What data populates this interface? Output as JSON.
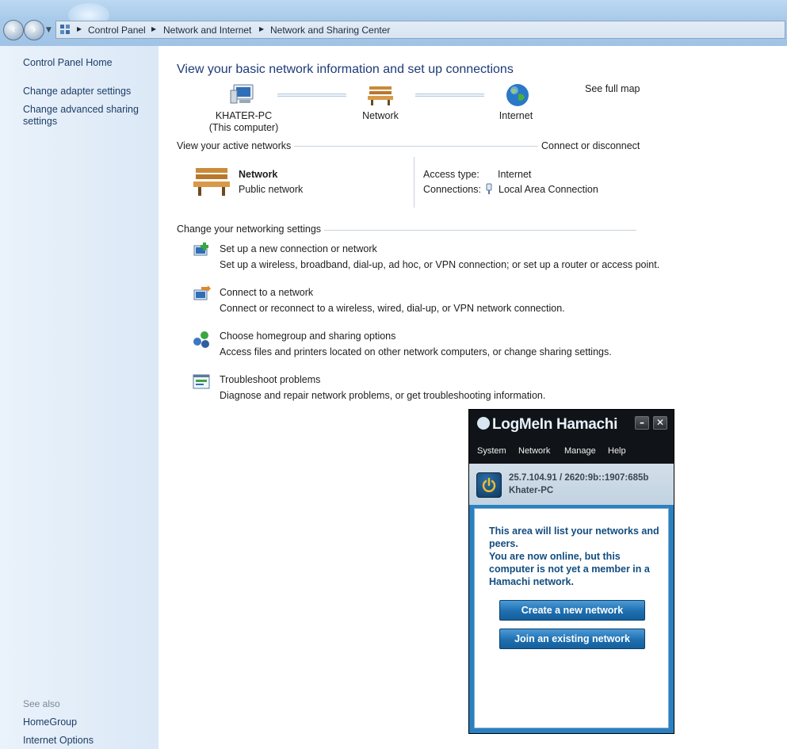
{
  "breadcrumb": [
    "Control Panel",
    "Network and Internet",
    "Network and Sharing Center"
  ],
  "sidebar": {
    "items": [
      {
        "label": "Control Panel Home"
      },
      {
        "label": "Change adapter settings"
      },
      {
        "label": "Change advanced sharing settings"
      }
    ],
    "see_also_label": "See also",
    "see_also": [
      {
        "label": "HomeGroup"
      },
      {
        "label": "Internet Options"
      }
    ]
  },
  "main": {
    "title": "View your basic network information and set up connections",
    "see_full_map": "See full map",
    "map": {
      "computer_name": "KHATER-PC",
      "computer_sub": "(This computer)",
      "network": "Network",
      "internet": "Internet"
    },
    "active_networks_label": "View your active networks",
    "connect_disconnect": "Connect or disconnect",
    "active_network": {
      "name": "Network",
      "type": "Public network",
      "access_type_label": "Access type:",
      "access_type_value": "Internet",
      "connections_label": "Connections:",
      "connections_value": "Local Area Connection"
    },
    "change_settings_label": "Change your networking settings",
    "tasks": [
      {
        "title": "Set up a new connection or network",
        "desc": "Set up a wireless, broadband, dial-up, ad hoc, or VPN connection; or set up a router or access point."
      },
      {
        "title": "Connect to a network",
        "desc": "Connect or reconnect to a wireless, wired, dial-up, or VPN network connection."
      },
      {
        "title": "Choose homegroup and sharing options",
        "desc": "Access files and printers located on other network computers, or change sharing settings."
      },
      {
        "title": "Troubleshoot problems",
        "desc": "Diagnose and repair network problems, or get troubleshooting information."
      }
    ]
  },
  "hamachi": {
    "title": "LogMeIn Hamachi",
    "minimize": "–",
    "close": "✕",
    "menu": [
      "System",
      "Network",
      "Manage",
      "Help"
    ],
    "ip": "25.7.104.91 / 2620:9b::1907:685b",
    "host": "Khater-PC",
    "message": "This area will list your networks and peers.\nYou are now online, but this computer is not yet a member in a Hamachi network.",
    "create_button": "Create a new network",
    "join_button": "Join an existing network"
  },
  "colors": {
    "link": "#1a5aa8",
    "title": "#1e3a78",
    "sidebar_bg": "#dbe8f6",
    "hamachi_blue": "#2a80c1"
  }
}
